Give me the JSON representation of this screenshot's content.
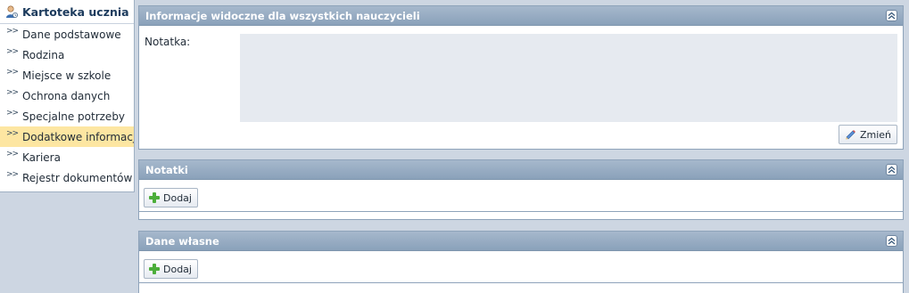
{
  "sidebar": {
    "title": "Kartoteka ucznia",
    "items": [
      {
        "label": "Dane podstawowe",
        "active": false
      },
      {
        "label": "Rodzina",
        "active": false
      },
      {
        "label": "Miejsce w szkole",
        "active": false
      },
      {
        "label": "Ochrona danych",
        "active": false
      },
      {
        "label": "Specjalne potrzeby",
        "active": false
      },
      {
        "label": "Dodatkowe informacje",
        "active": true
      },
      {
        "label": "Kariera",
        "active": false
      },
      {
        "label": "Rejestr dokumentów",
        "active": false
      }
    ]
  },
  "panels": {
    "info": {
      "title": "Informacje widoczne dla wszystkich nauczycieli",
      "note_label": "Notatka:",
      "change_label": "Zmień"
    },
    "notes": {
      "title": "Notatki",
      "add_label": "Dodaj"
    },
    "own": {
      "title": "Dane własne",
      "add_label": "Dodaj"
    }
  },
  "colors": {
    "active_item": "#fde6a2",
    "panel_header": "#8aa1ba",
    "background": "#cdd6e2",
    "note_area": "#e6eaf0"
  },
  "icons": [
    "student-icon",
    "chevron-right-icon",
    "collapse-up-icon",
    "pencil-icon",
    "plus-icon"
  ]
}
